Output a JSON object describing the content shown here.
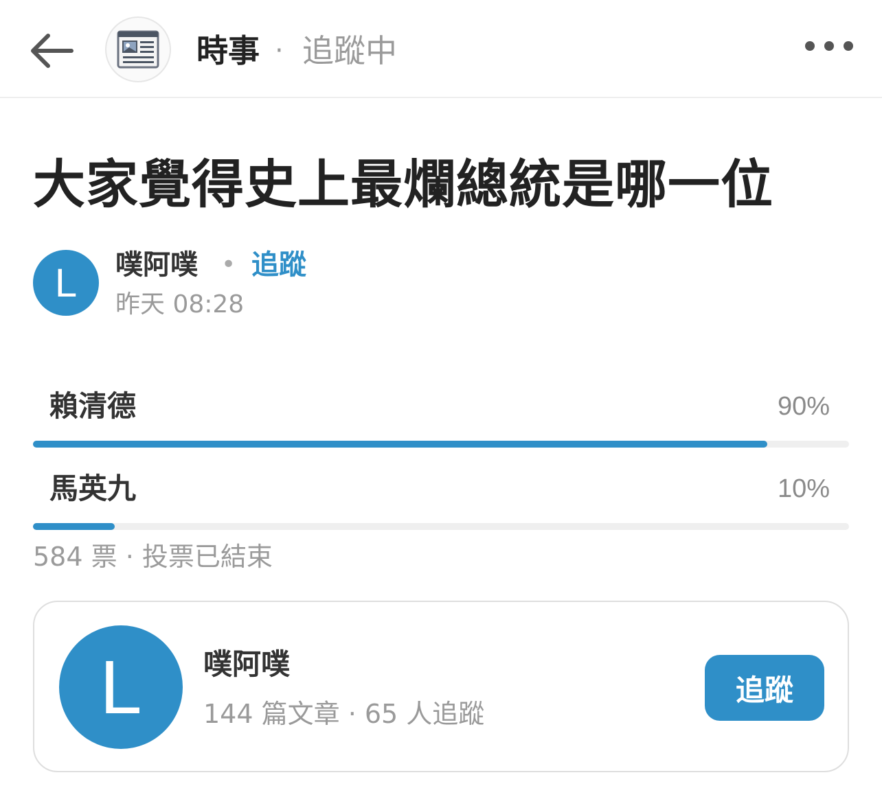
{
  "header": {
    "forum_icon": "newspaper-icon",
    "forum_name": "時事",
    "separator": "·",
    "follow_status": "追蹤中",
    "back_icon": "arrow-left-icon",
    "more_icon": "more-horizontal-icon"
  },
  "post": {
    "title": "大家覺得史上最爛總統是哪一位",
    "author": {
      "avatar_letter": "L",
      "name": "噗阿噗",
      "separator": "•",
      "follow_label": "追蹤",
      "time": "昨天 08:28"
    }
  },
  "poll": {
    "options": [
      {
        "label": "賴清德",
        "percent_text": "90%",
        "fraction": 0.9
      },
      {
        "label": "馬英九",
        "percent_text": "10%",
        "fraction": 0.1
      }
    ],
    "meta": "584 票 · 投票已結束"
  },
  "author_card": {
    "avatar_letter": "L",
    "name": "噗阿噗",
    "stats": "144 篇文章 · 65 人追蹤",
    "follow_button": "追蹤"
  },
  "colors": {
    "accent": "#2f8fc8",
    "muted_text": "#9a9a9a",
    "track": "#efefef"
  }
}
